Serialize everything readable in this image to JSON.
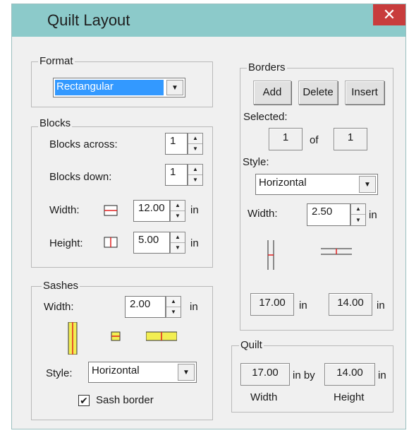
{
  "window": {
    "title": "Quilt Layout",
    "close_glyph": "✕"
  },
  "format": {
    "group_label": "Format",
    "selected": "Rectangular",
    "arrow_icon": "chevron-down-icon"
  },
  "blocks": {
    "group_label": "Blocks",
    "across_label": "Blocks across:",
    "across_value": "1",
    "down_label": "Blocks down:",
    "down_value": "1",
    "width_label": "Width:",
    "width_value": "12.00",
    "height_label": "Height:",
    "height_value": "5.00",
    "unit": "in"
  },
  "sashes": {
    "group_label": "Sashes",
    "width_label": "Width:",
    "width_value": "2.00",
    "unit": "in",
    "style_label": "Style:",
    "style_value": "Horizontal",
    "border_label": "Sash border",
    "border_checked": "✔",
    "accent": "#f2ee52"
  },
  "borders": {
    "group_label": "Borders",
    "add_label": "Add",
    "delete_label": "Delete",
    "insert_label": "Insert",
    "selected_label": "Selected:",
    "selected_index": "1",
    "of_label": "of",
    "selected_total": "1",
    "style_label": "Style:",
    "style_value": "Horizontal",
    "width_label": "Width:",
    "width_value": "2.50",
    "unit": "in",
    "dim_a": "17.00",
    "dim_b": "14.00"
  },
  "quilt": {
    "group_label": "Quilt",
    "width_value": "17.00",
    "by_label": "in by",
    "height_value": "14.00",
    "unit": "in",
    "width_caption": "Width",
    "height_caption": "Height"
  },
  "colors": {
    "titlebar": "#8ccaca",
    "close": "#c83c3c",
    "selection": "#3399ff",
    "marker": "#e02020"
  }
}
